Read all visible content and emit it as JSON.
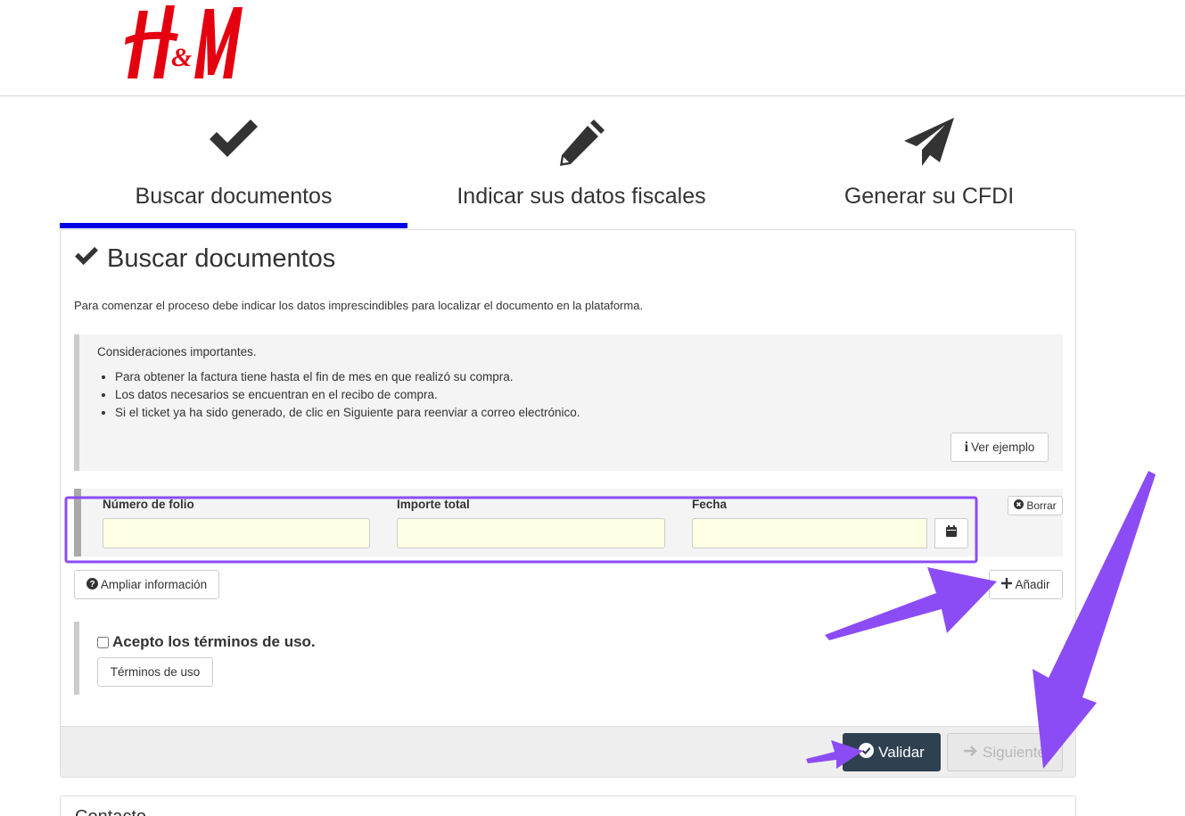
{
  "brand": {
    "logo_text": "H&M",
    "logo_color": "#e50010"
  },
  "steps": [
    {
      "label": "Buscar documentos",
      "icon": "check-icon",
      "active": true
    },
    {
      "label": "Indicar sus datos fiscales",
      "icon": "pencil-icon",
      "active": false
    },
    {
      "label": "Generar su CFDI",
      "icon": "paper-plane-icon",
      "active": false
    }
  ],
  "panel": {
    "title": "Buscar documentos",
    "intro": "Para comenzar el proceso debe indicar los datos imprescindibles para localizar el documento en la plataforma.",
    "notice": {
      "title": "Consideraciones importantes.",
      "items": [
        "Para obtener la factura tiene hasta el fin de mes en que realizó su compra.",
        "Los datos necesarios se encuentran en el recibo de compra.",
        "Si el ticket ya ha sido generado, de clic en Siguiente para reenviar a correo electrónico."
      ],
      "example_button": "Ver ejemplo"
    },
    "form": {
      "folio_label": "Número de folio",
      "folio_value": "",
      "importe_label": "Importe total",
      "importe_value": "",
      "fecha_label": "Fecha",
      "fecha_value": "",
      "clear_button": "Borrar"
    },
    "more_info_button": "Ampliar información",
    "add_button": "Añadir",
    "terms": {
      "checkbox_label": "Acepto los términos de uso.",
      "checked": false,
      "terms_button": "Términos de uso"
    },
    "footer": {
      "validate_button": "Validar",
      "next_button": "Siguiente"
    }
  },
  "contact": {
    "title": "Contacto"
  },
  "colors": {
    "active_step": "#0000e6",
    "annotation": "#8c4cf5",
    "validate_bg": "#2f4050",
    "input_bg": "#ffffe5"
  }
}
